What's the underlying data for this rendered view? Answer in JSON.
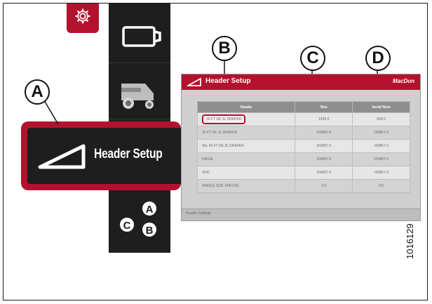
{
  "callouts": {
    "a": "A",
    "b": "B",
    "c": "C",
    "d": "D"
  },
  "menu": {
    "header_setup_label": "Header Setup",
    "icon_gear": "gear-icon",
    "icon_header": "header-icon",
    "icon_combine": "combine-icon",
    "icon_abc": "abc-icon",
    "abc_letters": [
      "C",
      "A",
      "B"
    ]
  },
  "screen": {
    "title": "Header Setup",
    "brand": "MacDon",
    "columns": [
      "Header",
      "Size",
      "Serial Num"
    ],
    "rows": [
      {
        "name": "30 FT DE 3L DRAPER",
        "size": "1435.0",
        "serial": "009.0",
        "selected": true
      },
      {
        "name": "35 FT DE 3L DRAPER",
        "size": "169857.5",
        "serial": "169857.5"
      },
      {
        "name": "40L 45 FT DE 3L DRAPER",
        "size": "169857.5",
        "serial": "169857.5"
      },
      {
        "name": "HINGE",
        "size": "169857.5",
        "serial": "169857.5"
      },
      {
        "name": "SKIC",
        "size": "169857.5",
        "serial": "169857.5"
      },
      {
        "name": "SINGLE SIZE SPECIAL",
        "size": "0.0",
        "serial": "0.0"
      }
    ],
    "footer": "Header Settings"
  },
  "figure_id": "1016129",
  "colors": {
    "accent": "#b3122e",
    "dark": "#1e1e1e"
  }
}
